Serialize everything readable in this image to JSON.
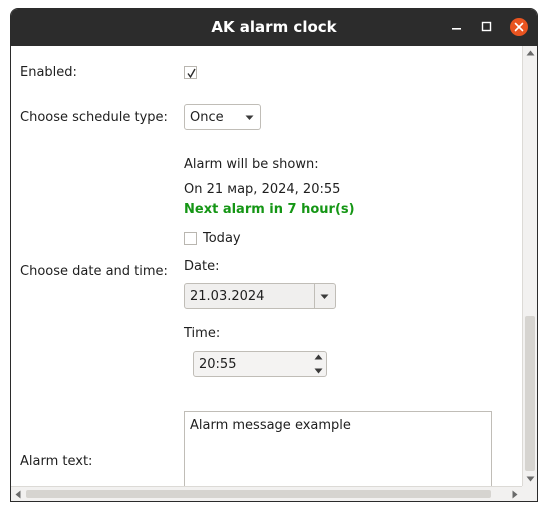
{
  "window": {
    "title": "AK alarm clock"
  },
  "form": {
    "enabled_label": "Enabled:",
    "enabled_checked": true,
    "schedule_label": "Choose schedule type:",
    "schedule_value": "Once",
    "datetime_label": "Choose date and time:",
    "alarm_shown_label": "Alarm will be shown:",
    "alarm_shown_value": "On 21 мар, 2024, 20:55",
    "next_alarm": "Next alarm in 7 hour(s)",
    "today_label": "Today",
    "today_checked": false,
    "date_label": "Date:",
    "date_value": "21.03.2024",
    "time_label": "Time:",
    "time_value": "20:55",
    "alarm_text_label": "Alarm text:",
    "alarm_text_value": "Alarm message example"
  },
  "colors": {
    "titlebar": "#2c2c2c",
    "close_button": "#e95420",
    "next_alarm": "#159615"
  },
  "icons": {
    "minimize": "minimize-icon",
    "maximize": "maximize-icon",
    "close": "close-icon",
    "dropdown": "chevron-down-icon",
    "checkmark": "checkmark-icon"
  }
}
